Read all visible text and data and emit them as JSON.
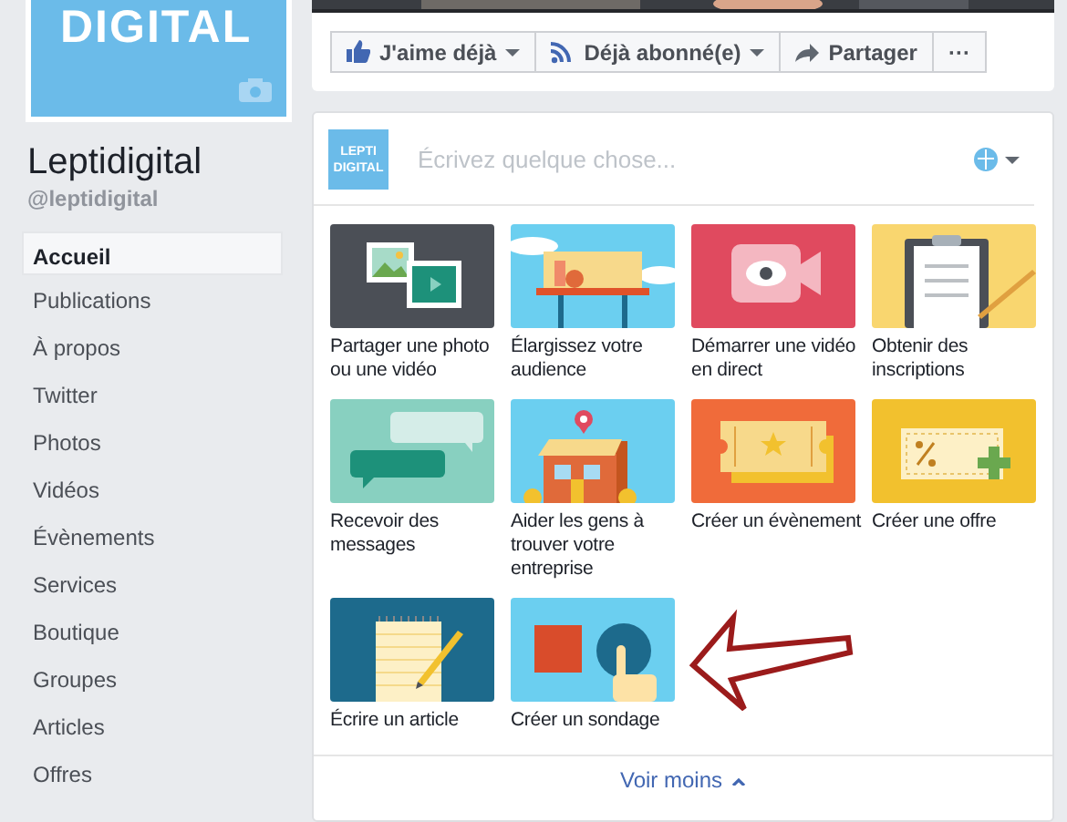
{
  "profile": {
    "logo_text": "DIGITAL",
    "name": "Leptidigital",
    "handle": "@leptidigital"
  },
  "nav": [
    {
      "label": "Accueil",
      "selected": true
    },
    {
      "label": "Publications",
      "selected": false
    },
    {
      "label": "À propos",
      "selected": false
    },
    {
      "label": "Twitter",
      "selected": false
    },
    {
      "label": "Photos",
      "selected": false
    },
    {
      "label": "Vidéos",
      "selected": false
    },
    {
      "label": "Évènements",
      "selected": false
    },
    {
      "label": "Services",
      "selected": false
    },
    {
      "label": "Boutique",
      "selected": false
    },
    {
      "label": "Groupes",
      "selected": false
    },
    {
      "label": "Articles",
      "selected": false
    },
    {
      "label": "Offres",
      "selected": false
    }
  ],
  "actions": [
    {
      "label": "J'aime déjà",
      "kind": "like",
      "dropdown": true
    },
    {
      "label": "Déjà abonné(e)",
      "kind": "rss",
      "dropdown": true
    },
    {
      "label": "Partager",
      "kind": "share",
      "dropdown": false
    },
    {
      "label": "···",
      "kind": "more",
      "dropdown": false
    }
  ],
  "composer": {
    "avatar_text": "LEPTI DIGITAL",
    "placeholder": "Écrivez quelque chose..."
  },
  "tiles": [
    {
      "caption": "Partager une photo ou une vidéo"
    },
    {
      "kind": "audience",
      "caption": "Élargissez votre audience"
    },
    {
      "kind": "live",
      "caption": "Démarrer une vidéo en direct"
    },
    {
      "kind": "signup",
      "caption": "Obtenir des inscriptions"
    },
    {
      "kind": "messages",
      "caption": "Recevoir des messages"
    },
    {
      "kind": "business",
      "caption": "Aider les gens à trouver votre entreprise"
    },
    {
      "kind": "event",
      "caption": "Créer un évènement"
    },
    {
      "kind": "offer",
      "caption": "Créer une offre"
    },
    {
      "kind": "article",
      "caption": "Écrire un article"
    },
    {
      "kind": "poll",
      "caption": "Créer un sondage"
    }
  ],
  "footer_link": "Voir moins",
  "annotation": {
    "kind": "arrow"
  }
}
